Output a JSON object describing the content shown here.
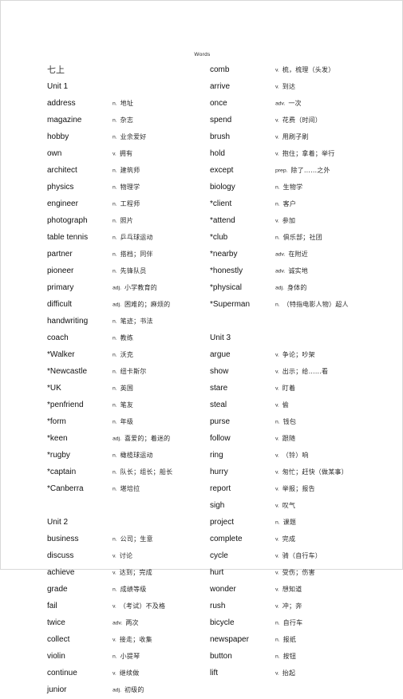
{
  "header": {
    "running_title": "Words"
  },
  "book": {
    "volume_label": "七上"
  },
  "columns": {
    "left": [
      {
        "kind": "unit",
        "label": "Unit 1"
      },
      {
        "kind": "word",
        "word": "address",
        "pos": "n.",
        "def": "地址"
      },
      {
        "kind": "word",
        "word": "magazine",
        "pos": "n.",
        "def": "杂志"
      },
      {
        "kind": "word",
        "word": "hobby",
        "pos": "n.",
        "def": "业余爱好"
      },
      {
        "kind": "word",
        "word": "own",
        "pos": "v.",
        "def": "拥有"
      },
      {
        "kind": "word",
        "word": "architect",
        "pos": "n.",
        "def": "建筑师"
      },
      {
        "kind": "word",
        "word": "physics",
        "pos": "n.",
        "def": "物理学"
      },
      {
        "kind": "word",
        "word": "engineer",
        "pos": "n.",
        "def": "工程师"
      },
      {
        "kind": "word",
        "word": "photograph",
        "pos": "n.",
        "def": "照片"
      },
      {
        "kind": "word",
        "word": "table tennis",
        "pos": "n.",
        "def": "乒乓球运动"
      },
      {
        "kind": "word",
        "word": "partner",
        "pos": "n.",
        "def": "搭档；同伴"
      },
      {
        "kind": "word",
        "word": "pioneer",
        "pos": "n.",
        "def": "先锋队员"
      },
      {
        "kind": "word",
        "word": "primary",
        "pos": "adj.",
        "def": "小学教育的"
      },
      {
        "kind": "word",
        "word": "difficult",
        "pos": "adj.",
        "def": "困难的；麻烦的"
      },
      {
        "kind": "word",
        "word": "handwriting",
        "pos": "n.",
        "def": "笔迹；书法"
      },
      {
        "kind": "word",
        "word": "coach",
        "pos": "n.",
        "def": "教练"
      },
      {
        "kind": "word",
        "word": "*Walker",
        "pos": "n.",
        "def": "沃克"
      },
      {
        "kind": "word",
        "word": "*Newcastle",
        "pos": "n.",
        "def": "纽卡斯尔"
      },
      {
        "kind": "word",
        "word": "*UK",
        "pos": "n.",
        "def": "英国"
      },
      {
        "kind": "word",
        "word": "*penfriend",
        "pos": "n.",
        "def": "笔友"
      },
      {
        "kind": "word",
        "word": "*form",
        "pos": "n.",
        "def": "年级"
      },
      {
        "kind": "word",
        "word": "*keen",
        "pos": "adj.",
        "def": "喜爱的；着迷的"
      },
      {
        "kind": "word",
        "word": "*rugby",
        "pos": "n.",
        "def": "橄榄球运动"
      },
      {
        "kind": "word",
        "word": "*captain",
        "pos": "n.",
        "def": "队长；组长；船长"
      },
      {
        "kind": "word",
        "word": "*Canberra",
        "pos": "n.",
        "def": "堪培拉"
      },
      {
        "kind": "spacer"
      },
      {
        "kind": "unit",
        "label": "Unit 2"
      },
      {
        "kind": "word",
        "word": "business",
        "pos": "n.",
        "def": "公司；生意"
      },
      {
        "kind": "word",
        "word": "discuss",
        "pos": "v.",
        "def": "讨论"
      },
      {
        "kind": "word",
        "word": "achieve",
        "pos": "v.",
        "def": "达到；完成"
      },
      {
        "kind": "word",
        "word": "grade",
        "pos": "n.",
        "def": "成绩等级"
      },
      {
        "kind": "word",
        "word": "fail",
        "pos": "v.",
        "def": "（考试）不及格"
      },
      {
        "kind": "word",
        "word": "twice",
        "pos": "adv.",
        "def": "两次"
      },
      {
        "kind": "word",
        "word": "collect",
        "pos": "v.",
        "def": "接走；收集"
      },
      {
        "kind": "word",
        "word": "violin",
        "pos": "n.",
        "def": "小提琴"
      },
      {
        "kind": "word",
        "word": "continue",
        "pos": "v.",
        "def": "继续做"
      },
      {
        "kind": "word",
        "word": "junior",
        "pos": "adj.",
        "def": "初级的"
      }
    ],
    "right": [
      {
        "kind": "word",
        "word": "comb",
        "pos": "v.",
        "def": "梳，梳理（头发）"
      },
      {
        "kind": "word",
        "word": "arrive",
        "pos": "v.",
        "def": "到达"
      },
      {
        "kind": "word",
        "word": "once",
        "pos": "adv.",
        "def": "一次"
      },
      {
        "kind": "word",
        "word": "spend",
        "pos": "v.",
        "def": "花费（时间）"
      },
      {
        "kind": "word",
        "word": "brush",
        "pos": "v.",
        "def": "用刷子刷"
      },
      {
        "kind": "word",
        "word": "hold",
        "pos": "v.",
        "def": "抱住；拿着；举行"
      },
      {
        "kind": "word",
        "word": "except",
        "pos": "prep.",
        "def": "除了……之外"
      },
      {
        "kind": "word",
        "word": "biology",
        "pos": "n.",
        "def": "生物学"
      },
      {
        "kind": "word",
        "word": "*client",
        "pos": "n.",
        "def": "客户"
      },
      {
        "kind": "word",
        "word": "*attend",
        "pos": "v.",
        "def": "参加"
      },
      {
        "kind": "word",
        "word": "*club",
        "pos": "n.",
        "def": "俱乐部；社团"
      },
      {
        "kind": "word",
        "word": "*nearby",
        "pos": "adv.",
        "def": "在附近"
      },
      {
        "kind": "word",
        "word": "*honestly",
        "pos": "adv.",
        "def": "诚实地"
      },
      {
        "kind": "word",
        "word": "*physical",
        "pos": "adj.",
        "def": "身体的"
      },
      {
        "kind": "word",
        "word": "*Superman",
        "pos": "n.",
        "def": "（特指电影人物）超人"
      },
      {
        "kind": "spacer"
      },
      {
        "kind": "unit",
        "label": "Unit 3"
      },
      {
        "kind": "word",
        "word": "argue",
        "pos": "v.",
        "def": "争论；吵架"
      },
      {
        "kind": "word",
        "word": "show",
        "pos": "v.",
        "def": "出示；给……看"
      },
      {
        "kind": "word",
        "word": "stare",
        "pos": "v.",
        "def": "盯着"
      },
      {
        "kind": "word",
        "word": "steal",
        "pos": "v.",
        "def": "偷"
      },
      {
        "kind": "word",
        "word": "purse",
        "pos": "n.",
        "def": "钱包"
      },
      {
        "kind": "word",
        "word": "follow",
        "pos": "v.",
        "def": "跟随"
      },
      {
        "kind": "word",
        "word": "ring",
        "pos": "v.",
        "def": "（铃）响"
      },
      {
        "kind": "word",
        "word": "hurry",
        "pos": "v.",
        "def": "匆忙；赶快（做某事）"
      },
      {
        "kind": "word",
        "word": "report",
        "pos": "v.",
        "def": "举报；报告"
      },
      {
        "kind": "word",
        "word": "sigh",
        "pos": "v.",
        "def": "叹气"
      },
      {
        "kind": "word",
        "word": "project",
        "pos": "n.",
        "def": "课题"
      },
      {
        "kind": "word",
        "word": "complete",
        "pos": "v.",
        "def": "完成"
      },
      {
        "kind": "word",
        "word": "cycle",
        "pos": "v.",
        "def": "骑（自行车）"
      },
      {
        "kind": "word",
        "word": "hurt",
        "pos": "v.",
        "def": "受伤；伤害"
      },
      {
        "kind": "word",
        "word": "wonder",
        "pos": "v.",
        "def": "想知道"
      },
      {
        "kind": "word",
        "word": "rush",
        "pos": "v.",
        "def": "冲；奔"
      },
      {
        "kind": "word",
        "word": "bicycle",
        "pos": "n.",
        "def": "自行车"
      },
      {
        "kind": "word",
        "word": "newspaper",
        "pos": "n.",
        "def": "报纸"
      },
      {
        "kind": "word",
        "word": "button",
        "pos": "n.",
        "def": "按钮"
      },
      {
        "kind": "word",
        "word": "lift",
        "pos": "v.",
        "def": "抬起"
      }
    ]
  }
}
